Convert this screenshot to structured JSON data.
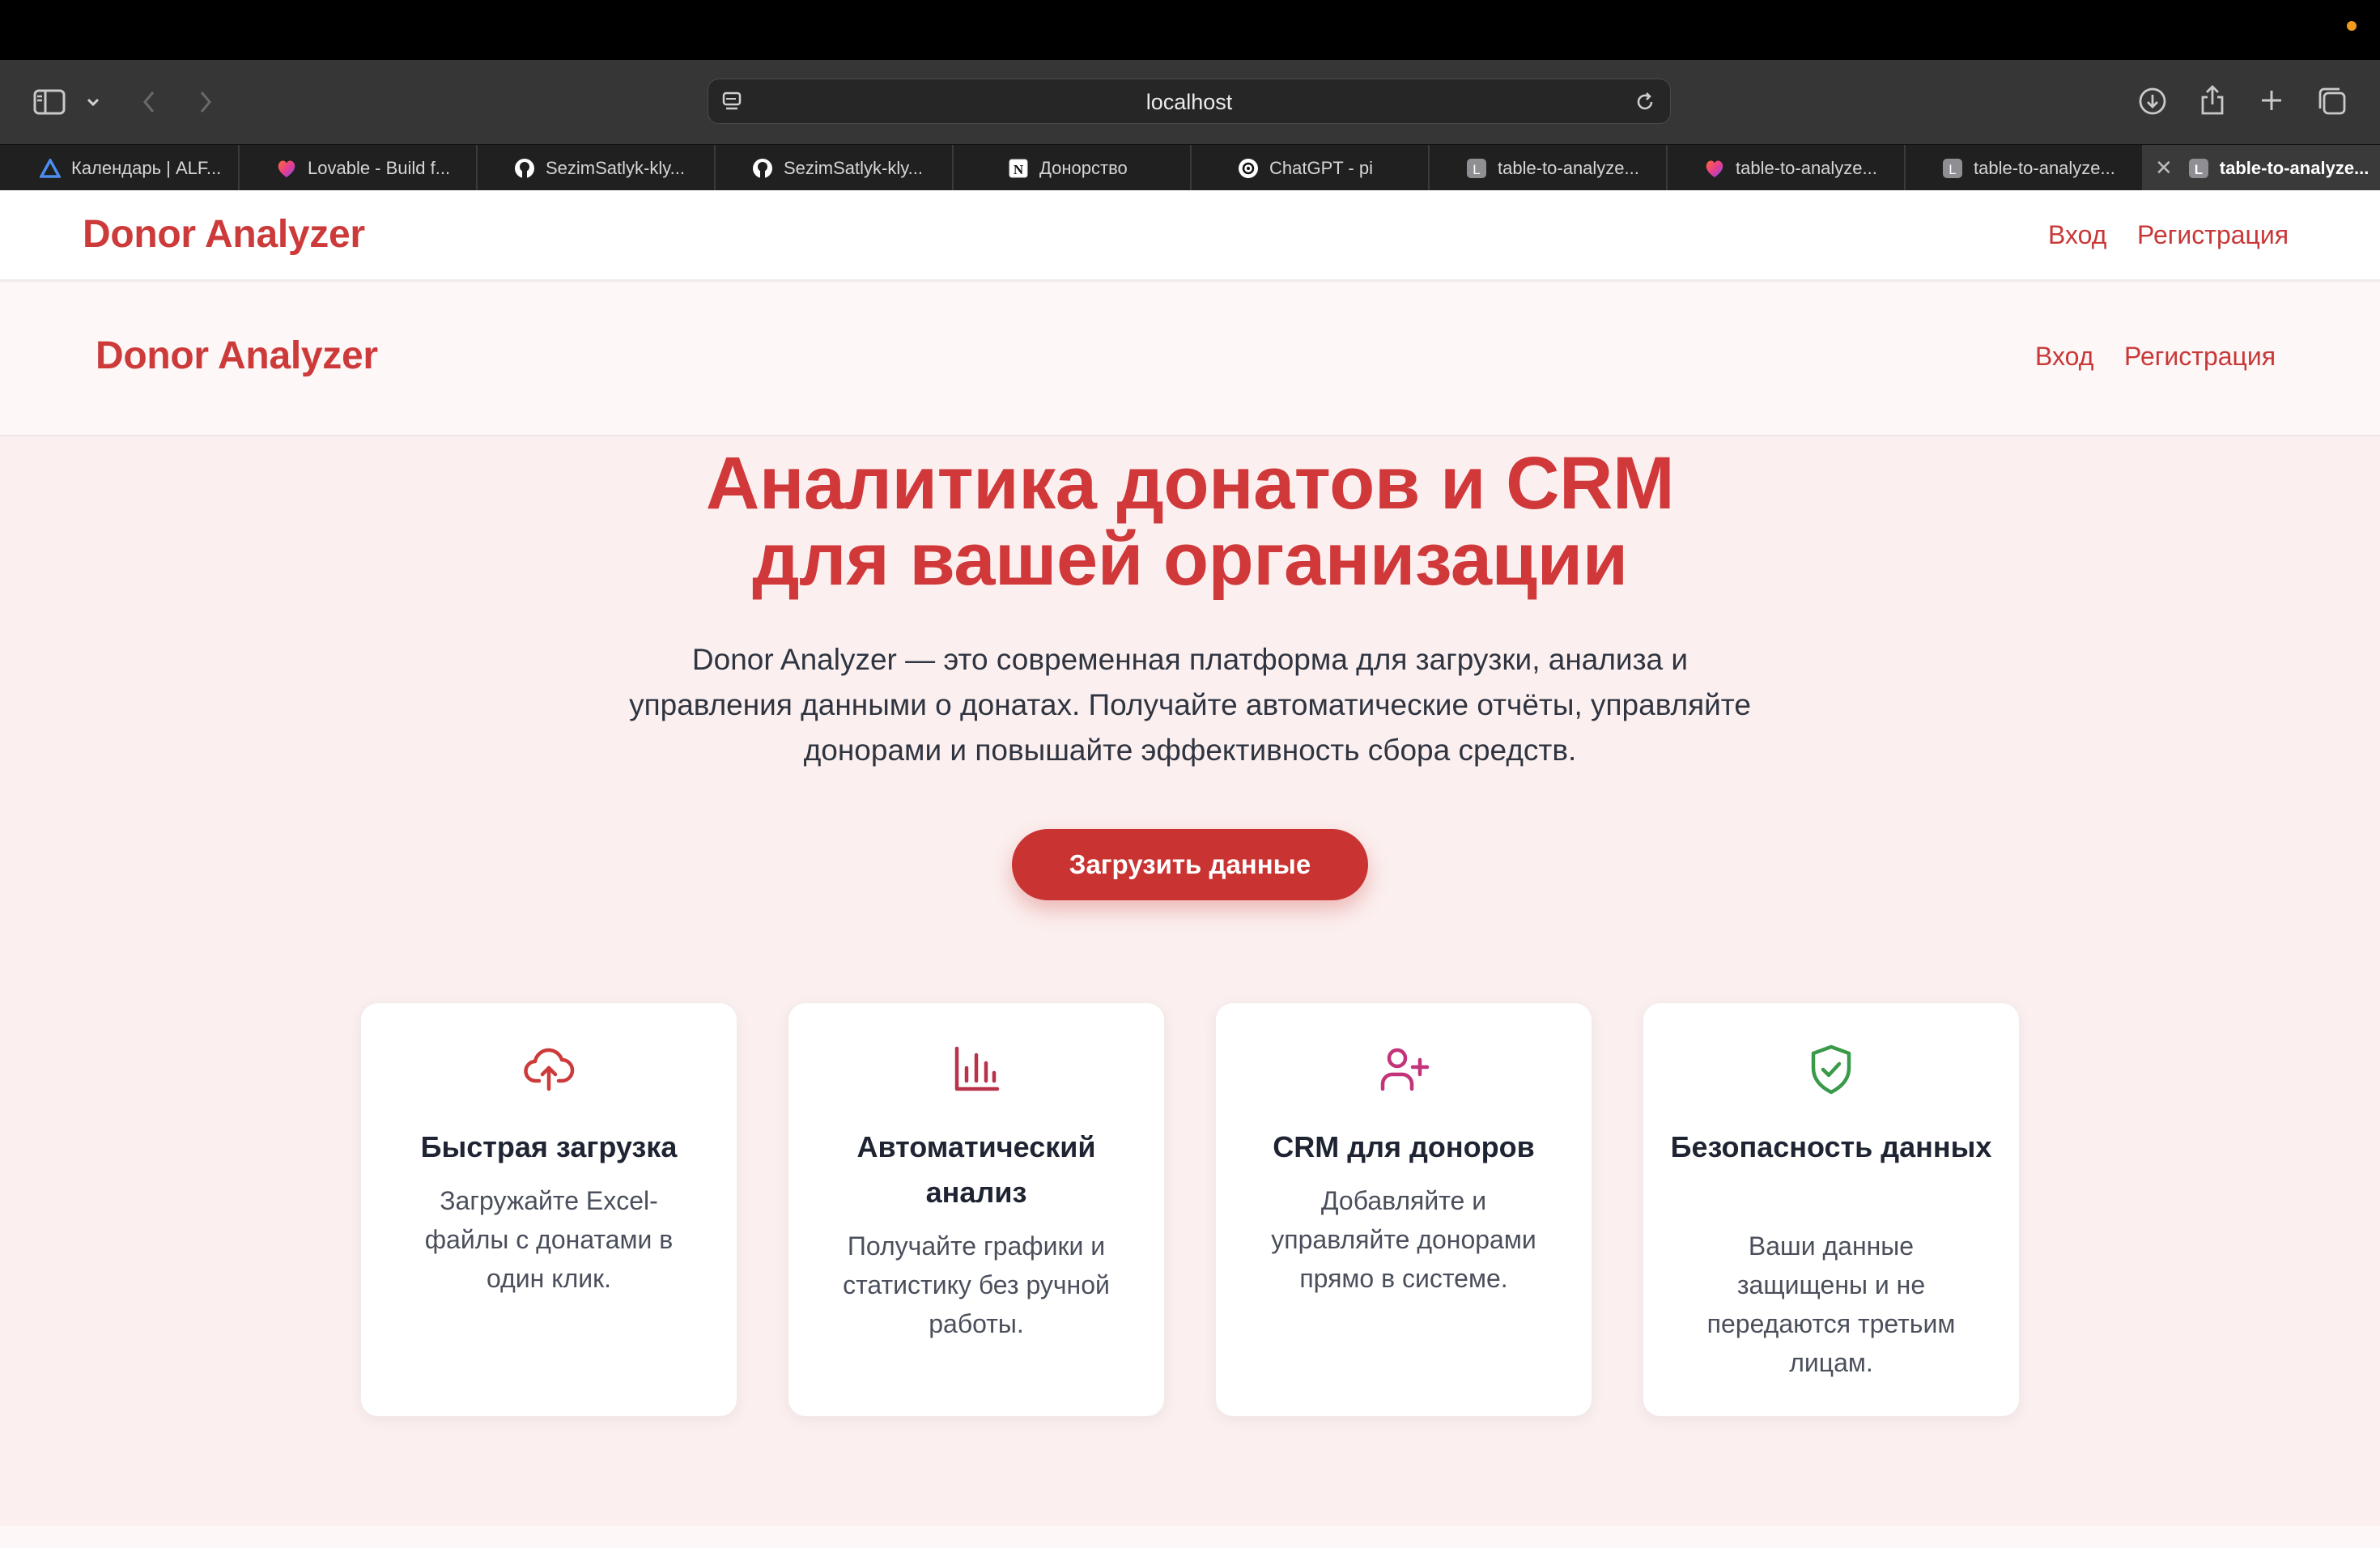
{
  "browser": {
    "url": "localhost",
    "tabs": [
      {
        "label": "Календарь | ALF...",
        "icon": "calendar-favicon"
      },
      {
        "label": "Lovable - Build f...",
        "icon": "lovable-favicon"
      },
      {
        "label": "SezimSatlyk-kly...",
        "icon": "github-favicon"
      },
      {
        "label": "SezimSatlyk-kly...",
        "icon": "github-favicon"
      },
      {
        "label": "Донорство",
        "icon": "notion-favicon"
      },
      {
        "label": "ChatGPT - pi",
        "icon": "chatgpt-favicon"
      },
      {
        "label": "table-to-analyze...",
        "icon": "letter-l-favicon"
      },
      {
        "label": "table-to-analyze...",
        "icon": "lovable-favicon"
      },
      {
        "label": "table-to-analyze...",
        "icon": "letter-l-favicon"
      },
      {
        "label": "table-to-analyze...",
        "icon": "letter-l-favicon",
        "active": true
      }
    ]
  },
  "nav": {
    "brand": "Donor Analyzer",
    "login": "Вход",
    "register": "Регистрация"
  },
  "hero": {
    "title_line1": "Аналитика донатов и CRM",
    "title_line2": "для вашей организации",
    "subtitle": "Donor Analyzer — это современная платформа для загрузки, анализа и управления данными о донатах. Получайте автоматические отчёты, управляйте донорами и повышайте эффективность сбора средств.",
    "cta": "Загрузить данные"
  },
  "features": [
    {
      "icon": "cloud-upload-icon",
      "title": "Быстрая загрузка",
      "desc": "Загружайте Excel-файлы с донатами в один клик."
    },
    {
      "icon": "bar-chart-icon",
      "title": "Автоматический анализ",
      "desc": "Получайте графики и статистику без ручной работы."
    },
    {
      "icon": "user-plus-icon",
      "title": "CRM для доноров",
      "desc": "Добавляйте и управляйте донорами прямо в системе."
    },
    {
      "icon": "shield-check-icon",
      "title": "Безопасность данных",
      "desc": "Ваши данные защищены и не передаются третьим лицам."
    }
  ],
  "colors": {
    "brand": "#cd3a3a",
    "cta": "#c93433",
    "page_bg": "#fbf0ef",
    "chart_icon": "#b8334a",
    "user_icon": "#c2347a",
    "shield_icon": "#3a9a4a"
  }
}
